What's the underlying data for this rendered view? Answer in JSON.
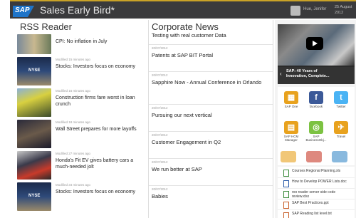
{
  "header": {
    "logo_text": "SAP",
    "app_title": "Sales Early Bird*",
    "user_name": "Hue, Jenifer",
    "date_line1": "25 August",
    "date_line2": "2012"
  },
  "rss": {
    "title": "RSS Reader",
    "first_headline": "CPI: No inflation in July",
    "items": [
      {
        "modified": "Modified 15 minutes ago",
        "headline": "Stocks: Investors focus on economy",
        "thumb_label": "NYSE"
      },
      {
        "modified": "Modified 16 minutes ago",
        "headline": "Construction firms fare worst in loan crunch",
        "thumb_label": ""
      },
      {
        "modified": "Modified 18 minutes ago",
        "headline": "Wall Street prepares for more layoffs",
        "thumb_label": ""
      },
      {
        "modified": "Modified 27 minutes ago",
        "headline": "Honda's Fit EV gives battery cars a much-needed jolt",
        "thumb_label": ""
      },
      {
        "modified": "Modified 34 minutes ago",
        "headline": "Stocks: Investors focus on economy",
        "thumb_label": "NYSE"
      }
    ]
  },
  "news": {
    "title": "Corporate News",
    "subtitle": "Testing with real customer Data",
    "items": [
      {
        "date": "20/07/2012",
        "title": "Patents at SAP BIT Portal"
      },
      {
        "date": "20/07/2012",
        "title": "Sapphire Now - Annual Conference in Orlando"
      },
      {
        "date": "20/07/2012",
        "title": "Pursuing our next vertical"
      },
      {
        "date": "20/07/2012",
        "title": "Customer Engagement in Q2"
      },
      {
        "date": "20/07/2012",
        "title": "We run better at SAP"
      },
      {
        "date": "20/07/2012",
        "title": "Babies"
      }
    ]
  },
  "video": {
    "caption_line1": "SAP: 40 Years of",
    "caption_line2": "Innovation, Complete..."
  },
  "apps": [
    {
      "label": "SAP One",
      "color": "#e8a21e",
      "glyph": "▦"
    },
    {
      "label": "facebook",
      "color": "#3b5998",
      "glyph": "f"
    },
    {
      "label": "Twitter",
      "color": "#4ab3f4",
      "glyph": "t"
    },
    {
      "label": "SAP HCM Manager",
      "color": "#e8a21e",
      "glyph": "▤"
    },
    {
      "label": "SAP BusinessObj...",
      "color": "#7cc242",
      "glyph": "◎"
    },
    {
      "label": "Travel",
      "color": "#e8a21e",
      "glyph": "✈"
    }
  ],
  "docs": [
    {
      "name": "Courses Regional Planning.xls"
    },
    {
      "name": "How to Develop POWER Lists.doc"
    },
    {
      "name": "roo reader server side code review.xlsx"
    },
    {
      "name": "SAP Best Practices.ppt"
    },
    {
      "name": "SAP Reading list level.txt"
    }
  ]
}
